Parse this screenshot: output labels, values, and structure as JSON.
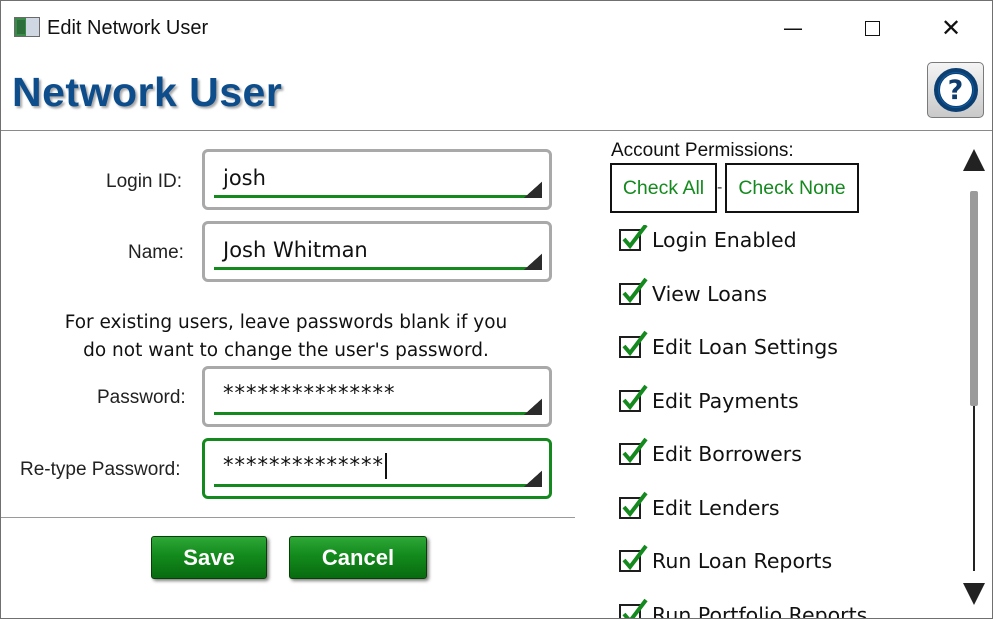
{
  "window": {
    "title": "Edit Network User",
    "minimize_glyph": "—",
    "close_glyph": "✕"
  },
  "header": {
    "title": "Network User",
    "help_icon": "question-circle-icon",
    "help_glyph": "?"
  },
  "form": {
    "login_id": {
      "label": "Login ID:",
      "value": "josh"
    },
    "name": {
      "label": "Name:",
      "value": "Josh Whitman"
    },
    "note_line1": "For existing users, leave passwords blank if you",
    "note_line2": "do not want to change the user's password.",
    "password": {
      "label": "Password:",
      "value": "***************"
    },
    "retype_password": {
      "label": "Re-type Password:",
      "value": "**************"
    }
  },
  "buttons": {
    "save": "Save",
    "cancel": "Cancel"
  },
  "permissions": {
    "title": "Account Permissions:",
    "check_all": "Check All",
    "separator": "-",
    "check_none": "Check None",
    "items": [
      {
        "label": "Login Enabled",
        "checked": true
      },
      {
        "label": "View Loans",
        "checked": true
      },
      {
        "label": "Edit Loan Settings",
        "checked": true
      },
      {
        "label": "Edit Payments",
        "checked": true
      },
      {
        "label": "Edit Borrowers",
        "checked": true
      },
      {
        "label": "Edit Lenders",
        "checked": true
      },
      {
        "label": "Run Loan Reports",
        "checked": true
      },
      {
        "label": "Run Portfolio Reports",
        "checked": true
      }
    ]
  },
  "colors": {
    "accent_green": "#148a1e",
    "title_blue": "#0e4d8c"
  }
}
